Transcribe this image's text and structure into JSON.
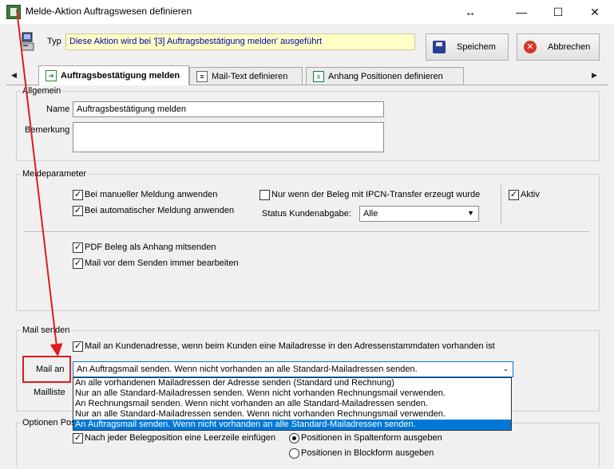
{
  "window": {
    "title": "Melde-Aktion Auftragswesen definieren",
    "controls": {
      "resize": "↔",
      "minimize": "—",
      "maximize": "☐",
      "close": "✕"
    }
  },
  "header": {
    "type_label": "Typ",
    "type_value": "Diese Aktion wird bei '[3] Auftragsbestätigung melden' ausgeführt",
    "save_label": "Speichem",
    "cancel_label": "Abbrechen"
  },
  "tabs": [
    {
      "label": "Auftragsbestätigung melden",
      "icon": "green-arrow-icon",
      "active": true
    },
    {
      "label": "Mail-Text definieren",
      "icon": "document-icon",
      "active": false
    },
    {
      "label": "Anhang Positionen definieren",
      "icon": "excel-icon",
      "active": false
    }
  ],
  "allgemein": {
    "group_label": "Allgemein",
    "name_label": "Name",
    "name_value": "Auftragsbestätigung melden",
    "bemerkung_label": "Bemerkung",
    "bemerkung_value": ""
  },
  "meldeparameter": {
    "group_label": "Meldeparameter",
    "manual_label": "Bei manueller Meldung anwenden",
    "auto_label": "Bei automatischer Meldung anwenden",
    "ipcn_label": "Nur wenn der Beleg mit IPCN-Transfer erzeugt wurde",
    "aktiv_label": "Aktiv",
    "status_label": "Status Kundenabgabe:",
    "status_value": "Alle",
    "pdf_label": "PDF Beleg als Anhang mitsenden",
    "edit_label": "Mail vor dem Senden immer bearbeiten"
  },
  "mail_senden": {
    "group_label": "Mail senden",
    "kunde_label": "Mail an Kundenadresse, wenn beim Kunden eine Mailadresse in den Adressenstammdaten vorhanden ist",
    "mail_an_label": "Mail an",
    "mail_an_value": "An Auftragsmail senden. Wenn nicht vorhanden an alle Standard-Mailadressen senden.",
    "mailliste_label": "Mailliste",
    "options": [
      "An alle vorhandenen Mailadressen der Adresse senden (Standard und Rechnung)",
      "Nur an alle Standard-Mailadressen senden. Wenn nicht vorhanden Rechnungsmail verwenden.",
      "An Rechnungsmail senden. Wenn nicht vorhanden an alle Standard-Mailadressen senden.",
      "Nur an alle Standard-Mailadressen senden. Wenn nicht vorhanden Rechnungsmail verwenden.",
      "An Auftragsmail senden. Wenn nicht vorhanden an alle Standard-Mailadressen senden."
    ],
    "selected_index": 4
  },
  "optionen": {
    "group_label": "Optionen Pos",
    "leerzeile_label": "Nach jeder Belegposition eine Leerzeile einfügen",
    "spalten_label": "Positionen in Spaltenform ausgeben",
    "block_label": "Positionen in Blockform ausgeben"
  },
  "colors": {
    "accent": "#0078d7",
    "highlight": "#ffffc6",
    "annotation": "#e01b1b"
  }
}
